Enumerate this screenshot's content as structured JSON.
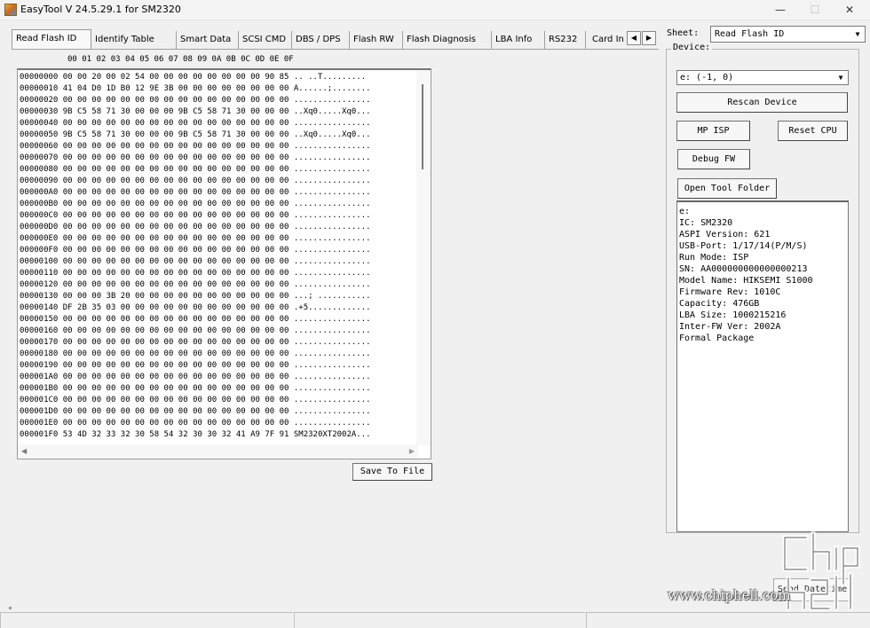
{
  "window": {
    "title": "EasyTool  V 24.5.29.1   for SM2320",
    "minimize_glyph": "—",
    "maximize_glyph": "☐",
    "close_glyph": "✕"
  },
  "tabs": [
    {
      "label": "Read Flash ID",
      "active": true
    },
    {
      "label": "Identify Table"
    },
    {
      "label": "Smart Data"
    },
    {
      "label": "SCSI CMD"
    },
    {
      "label": "DBS / DPS"
    },
    {
      "label": "Flash RW"
    },
    {
      "label": "Flash Diagnosis"
    },
    {
      "label": "LBA Info"
    },
    {
      "label": "RS232"
    },
    {
      "label": "Card In"
    }
  ],
  "tab_scroll": {
    "left_glyph": "◀",
    "right_glyph": "▶"
  },
  "hex": {
    "header": "00 01 02 03 04 05 06 07 08 09 0A 0B 0C 0D 0E 0F",
    "lines": [
      "00000000 00 00 20 00 02 54 00 00 00 00 00 00 00 00 90 85 .. ..T.........",
      "00000010 41 04 D0 1D B0 12 9E 3B 00 00 00 00 00 00 00 00 A......;........",
      "00000020 00 00 00 00 00 00 00 00 00 00 00 00 00 00 00 00 ................",
      "00000030 9B C5 58 71 30 00 00 00 9B C5 58 71 30 00 00 00 ..Xq0.....Xq0...",
      "00000040 00 00 00 00 00 00 00 00 00 00 00 00 00 00 00 00 ................",
      "00000050 9B C5 58 71 30 00 00 00 9B C5 58 71 30 00 00 00 ..Xq0.....Xq0...",
      "00000060 00 00 00 00 00 00 00 00 00 00 00 00 00 00 00 00 ................",
      "00000070 00 00 00 00 00 00 00 00 00 00 00 00 00 00 00 00 ................",
      "00000080 00 00 00 00 00 00 00 00 00 00 00 00 00 00 00 00 ................",
      "00000090 00 00 00 00 00 00 00 00 00 00 00 00 00 00 00 00 ................",
      "000000A0 00 00 00 00 00 00 00 00 00 00 00 00 00 00 00 00 ................",
      "000000B0 00 00 00 00 00 00 00 00 00 00 00 00 00 00 00 00 ................",
      "000000C0 00 00 00 00 00 00 00 00 00 00 00 00 00 00 00 00 ................",
      "000000D0 00 00 00 00 00 00 00 00 00 00 00 00 00 00 00 00 ................",
      "000000E0 00 00 00 00 00 00 00 00 00 00 00 00 00 00 00 00 ................",
      "000000F0 00 00 00 00 00 00 00 00 00 00 00 00 00 00 00 00 ................",
      "00000100 00 00 00 00 00 00 00 00 00 00 00 00 00 00 00 00 ................",
      "00000110 00 00 00 00 00 00 00 00 00 00 00 00 00 00 00 00 ................",
      "00000120 00 00 00 00 00 00 00 00 00 00 00 00 00 00 00 00 ................",
      "00000130 00 00 00 3B 20 00 00 00 00 00 00 00 00 00 00 00 ...; ...........",
      "00000140 DF 2B 35 03 00 00 00 00 00 00 00 00 00 00 00 00 .+5.............",
      "00000150 00 00 00 00 00 00 00 00 00 00 00 00 00 00 00 00 ................",
      "00000160 00 00 00 00 00 00 00 00 00 00 00 00 00 00 00 00 ................",
      "00000170 00 00 00 00 00 00 00 00 00 00 00 00 00 00 00 00 ................",
      "00000180 00 00 00 00 00 00 00 00 00 00 00 00 00 00 00 00 ................",
      "00000190 00 00 00 00 00 00 00 00 00 00 00 00 00 00 00 00 ................",
      "000001A0 00 00 00 00 00 00 00 00 00 00 00 00 00 00 00 00 ................",
      "000001B0 00 00 00 00 00 00 00 00 00 00 00 00 00 00 00 00 ................",
      "000001C0 00 00 00 00 00 00 00 00 00 00 00 00 00 00 00 00 ................",
      "000001D0 00 00 00 00 00 00 00 00 00 00 00 00 00 00 00 00 ................",
      "000001E0 00 00 00 00 00 00 00 00 00 00 00 00 00 00 00 00 ................",
      "000001F0 53 4D 32 33 32 30 58 54 32 30 30 32 41 A9 7F 91 SM2320XT2002A..."
    ],
    "scroll_left_glyph": "◀",
    "scroll_right_glyph": "▶"
  },
  "save_button": "Save To File",
  "sheet": {
    "label": "Sheet:",
    "value": "Read Flash ID",
    "arrow_glyph": "▼"
  },
  "device": {
    "legend": "Device:",
    "select_value": "e: (-1, 0)",
    "arrow_glyph": "▼",
    "rescan": "Rescan Device",
    "mp_isp": "MP ISP",
    "reset_cpu": "Reset CPU",
    "debug_fw": "Debug FW",
    "open_tool_folder": "Open Tool Folder",
    "info_lines": [
      "e:",
      "IC: SM2320",
      "ASPI Version: 621",
      "USB-Port: 1/17/14(P/M/S)",
      "Run Mode: ISP",
      "SN: AA000000000000000213",
      "Model Name: HIKSEMI S1000",
      "Firmware Rev: 1010C",
      "Capacity: 476GB",
      "LBA Size: 1000215216",
      "Inter-FW Ver: 2002A",
      "Formal Package"
    ]
  },
  "send_button": "Send Datetime",
  "watermark": {
    "text": "www.chiphell.com",
    "logo": "chip hell"
  },
  "colors": {
    "background": "#f0f0f0",
    "field": "#ffffff",
    "border": "#7a7a7a"
  }
}
